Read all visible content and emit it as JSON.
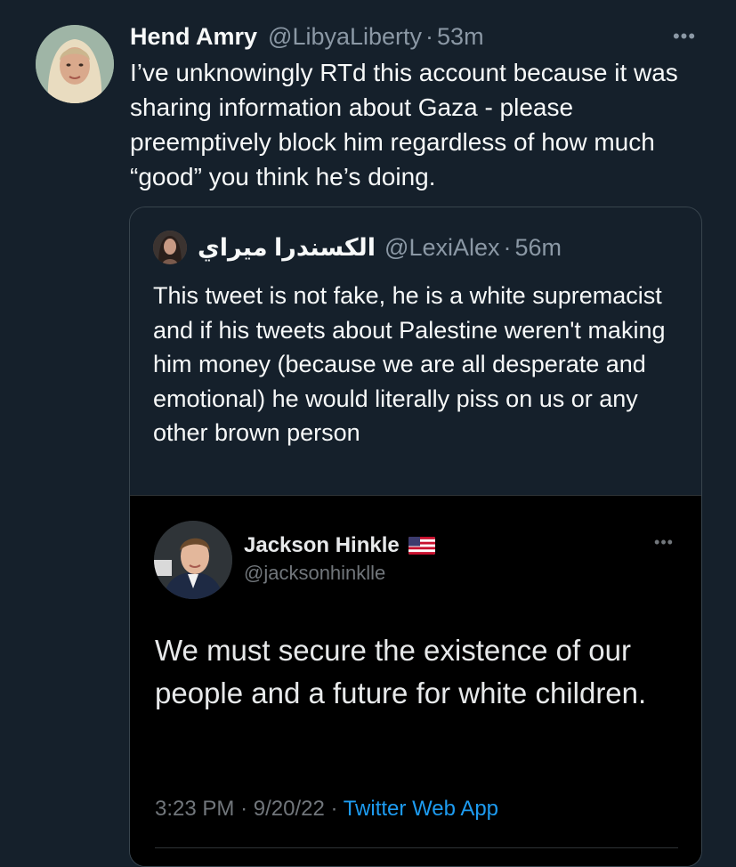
{
  "tweet": {
    "display_name": "Hend Amry",
    "handle": "@LibyaLiberty",
    "separator": "·",
    "timestamp": "53m",
    "more_icon": "more-horizontal-icon",
    "text": "I’ve unknowingly RTd this account because it was sharing information about Gaza - please preemptively block him regardless of how much “good” you think he’s doing."
  },
  "quoted_tweet": {
    "display_name": "الكسندرا ميراي",
    "handle": "@LexiAlex",
    "separator": "·",
    "timestamp": "56m",
    "text": "This tweet is not fake, he is a white supremacist and if his tweets about Palestine weren't making him money (because we are all desperate and emotional) he would literally piss on us or any other brown person",
    "embedded_screenshot": {
      "display_name": "Jackson Hinkle",
      "flag_icon": "us-flag-icon",
      "handle": "@jacksonhinklle",
      "more_icon": "more-horizontal-icon",
      "text": "We must secure the existence of our people and a future for white children.",
      "time": "3:23 PM",
      "date": "9/20/22",
      "separator": "·",
      "source": "Twitter Web App"
    }
  },
  "colors": {
    "background": "#15202b",
    "primary_text": "#f7f9f9",
    "secondary_text": "#8b98a5",
    "border": "#38444d",
    "link": "#1d9bf0",
    "embedded_background": "#000000"
  }
}
